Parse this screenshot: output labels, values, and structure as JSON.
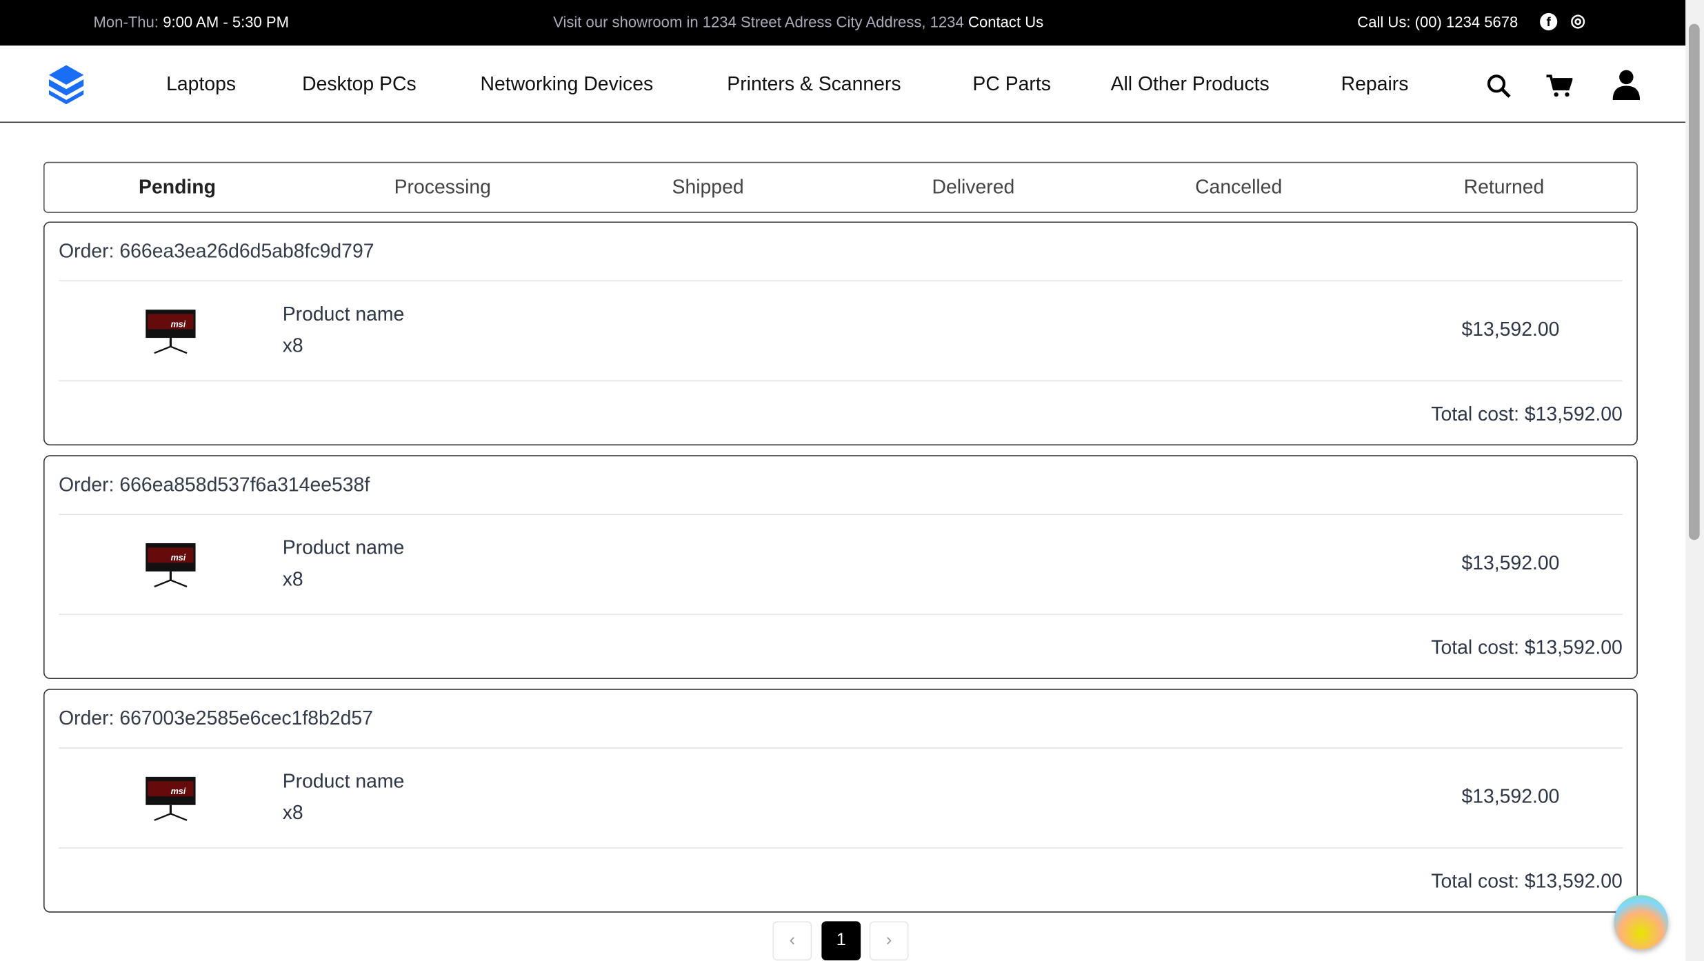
{
  "topbar": {
    "hours_label": "Mon-Thu:",
    "hours_value": "9:00 AM - 5:30 PM",
    "visit_text": "Visit our showroom in 1234 Street Adress City Address, 1234",
    "contact_link": "Contact Us",
    "call": "Call Us: (00) 1234 5678",
    "facebook_glyph": "f",
    "instagram_glyph": "◎"
  },
  "nav": {
    "items": [
      "Laptops",
      "Desktop PCs",
      "Networking Devices",
      "Printers & Scanners",
      "PC Parts",
      "All Other Products",
      "Repairs"
    ]
  },
  "tabs": [
    "Pending",
    "Processing",
    "Shipped",
    "Delivered",
    "Cancelled",
    "Returned"
  ],
  "orders": [
    {
      "id": "Order: 666ea3ea26d6d5ab8fc9d797",
      "product": "Product name",
      "qty": "x8",
      "price": "$13,592.00",
      "total": "Total cost: $13,592.00",
      "brand": "msi"
    },
    {
      "id": "Order: 666ea858d537f6a314ee538f",
      "product": "Product name",
      "qty": "x8",
      "price": "$13,592.00",
      "total": "Total cost: $13,592.00",
      "brand": "msi"
    },
    {
      "id": "Order: 667003e2585e6cec1f8b2d57",
      "product": "Product name",
      "qty": "x8",
      "price": "$13,592.00",
      "total": "Total cost: $13,592.00",
      "brand": "msi"
    }
  ],
  "pagination": {
    "prev": "‹",
    "current": "1",
    "next": "›"
  },
  "colors": {
    "brand": "#1a6ef5",
    "topbar": "#000000"
  }
}
